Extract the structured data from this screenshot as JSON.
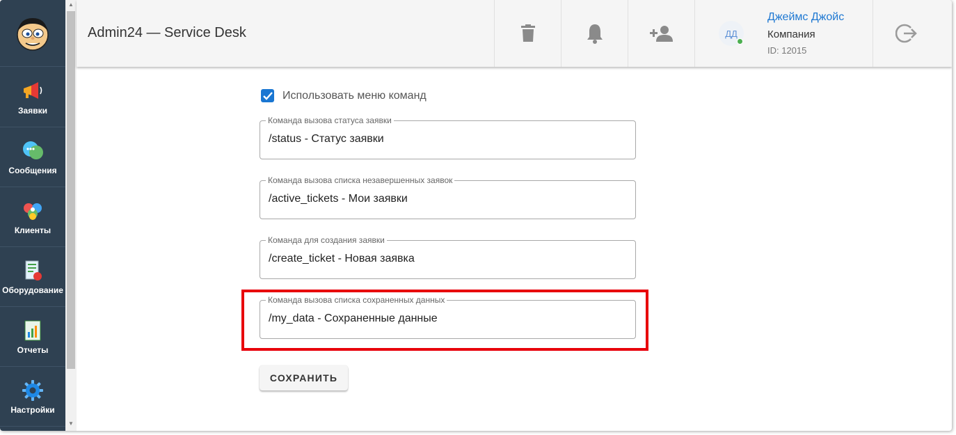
{
  "header": {
    "title": "Admin24 — Service Desk",
    "user": {
      "initials": "ДД",
      "name": "Джеймс Джойс",
      "company": "Компания",
      "id": "ID: 12015"
    }
  },
  "sidebar": {
    "items": [
      {
        "label": "Заявки",
        "icon": "megaphone-icon"
      },
      {
        "label": "Сообщения",
        "icon": "chat-bubbles-icon"
      },
      {
        "label": "Клиенты",
        "icon": "clients-icon"
      },
      {
        "label": "Оборудование",
        "icon": "equipment-icon"
      },
      {
        "label": "Отчеты",
        "icon": "report-chart-icon"
      },
      {
        "label": "Настройки",
        "icon": "gear-icon"
      }
    ]
  },
  "form": {
    "use_command_menu": {
      "label": "Использовать меню команд",
      "checked": true
    },
    "fields": [
      {
        "label": "Команда вызова статуса заявки",
        "value": "/status - Статус заявки"
      },
      {
        "label": "Команда вызова списка незавершенных заявок",
        "value": "/active_tickets - Мои заявки"
      },
      {
        "label": "Команда для создания заявки",
        "value": "/create_ticket - Новая заявка"
      },
      {
        "label": "Команда вызова списка сохраненных данных",
        "value": "/my_data - Сохраненные данные"
      }
    ],
    "save_label": "СОХРАНИТЬ"
  },
  "colors": {
    "sidebar_bg": "#2f4152",
    "accent": "#1976d2",
    "highlight": "#e8000b",
    "link": "#1e78d2",
    "online": "#4caf50"
  }
}
